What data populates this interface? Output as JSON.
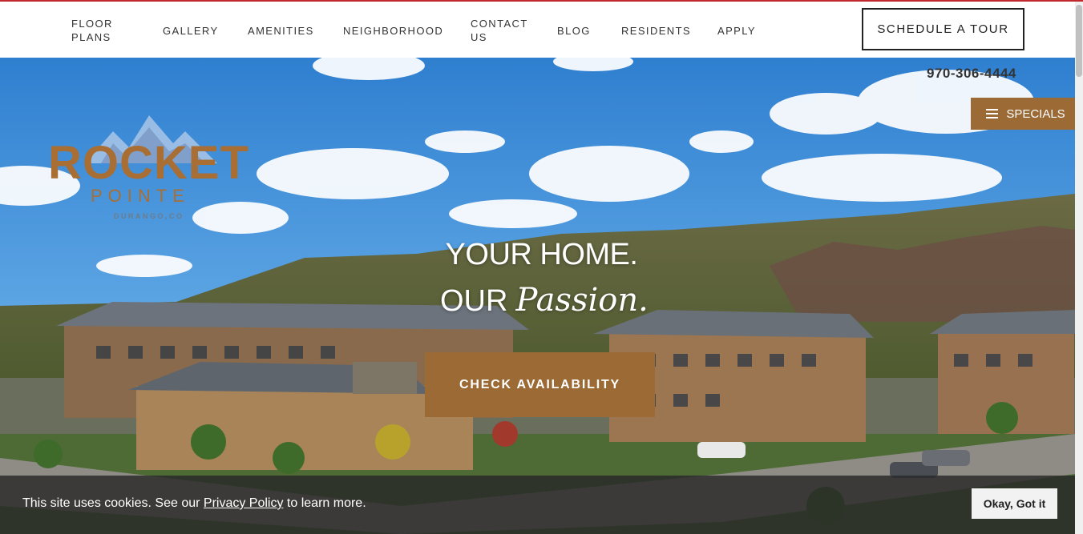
{
  "nav": {
    "items": [
      {
        "label": "FLOOR PLANS",
        "lines": [
          "FLOOR",
          "PLANS"
        ]
      },
      {
        "label": "GALLERY"
      },
      {
        "label": "AMENITIES"
      },
      {
        "label": "NEIGHBORHOOD"
      },
      {
        "label": "CONTACT US",
        "lines": [
          "CONTACT",
          "US"
        ]
      },
      {
        "label": "BLOG"
      },
      {
        "label": "RESIDENTS"
      },
      {
        "label": "APPLY"
      }
    ],
    "tour_button": "SCHEDULE A TOUR"
  },
  "header": {
    "phone": "970-306-4444",
    "specials_label": "SPECIALS"
  },
  "logo": {
    "word": "ROCKET",
    "sub": "POINTE",
    "city": "DURANGO,CO"
  },
  "hero": {
    "headline_line1": "YOUR HOME.",
    "headline_line2_plain": "OUR",
    "headline_line2_script": "Passion.",
    "cta_label": "CHECK AVAILABILITY"
  },
  "cookie": {
    "text_before": "This site uses cookies. See our",
    "link_text": "Privacy Policy",
    "text_after": "to learn more.",
    "button_label": "Okay, Got it"
  },
  "colors": {
    "accent_brown": "#9b6a35",
    "top_line_red": "#c0282d"
  }
}
